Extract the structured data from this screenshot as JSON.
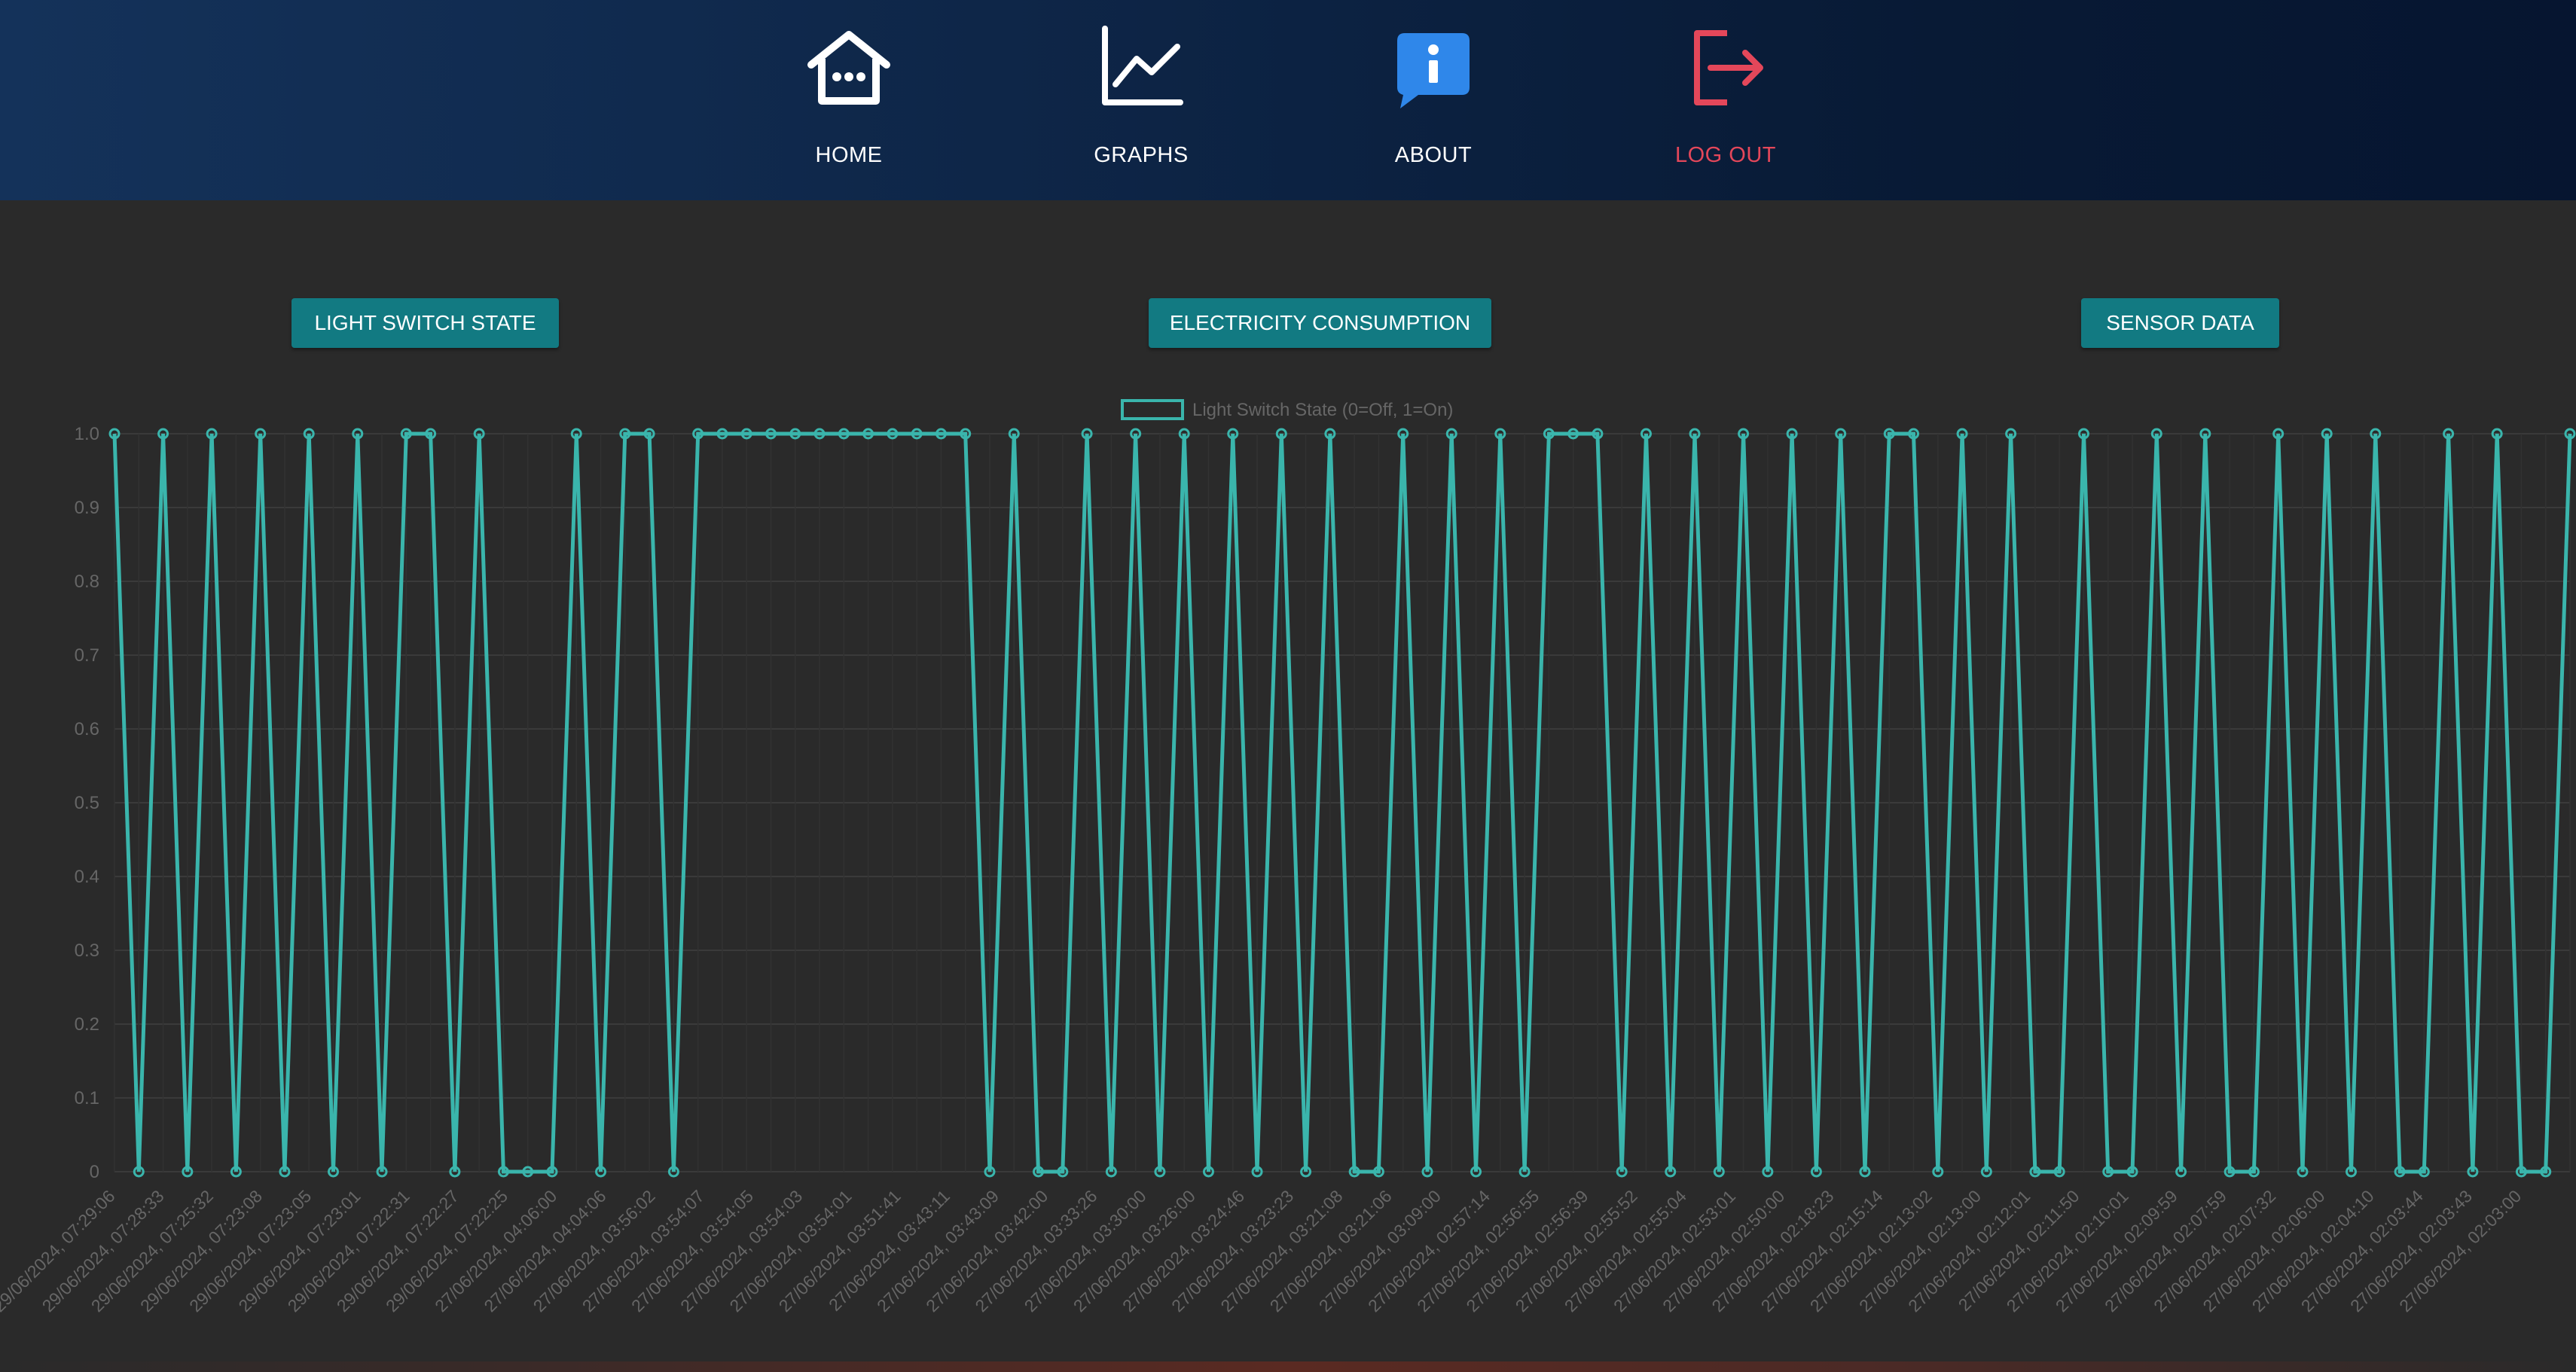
{
  "nav": {
    "items": [
      {
        "label": "HOME",
        "icon": "house-icon"
      },
      {
        "label": "GRAPHS",
        "icon": "line-chart-icon"
      },
      {
        "label": "ABOUT",
        "icon": "info-bubble-icon"
      },
      {
        "label": "LOG OUT",
        "icon": "logout-icon"
      }
    ]
  },
  "tabs": [
    {
      "label": "LIGHT SWITCH STATE"
    },
    {
      "label": "ELECTRICITY CONSUMPTION"
    },
    {
      "label": "SENSOR DATA"
    }
  ],
  "colors": {
    "accent": "#127a82",
    "series": "#3ab5ac",
    "logout": "#e4475a",
    "about_icon": "#2f87ea"
  },
  "chart_data": {
    "type": "line",
    "title": "",
    "legend": {
      "label": "Light Switch State (0=Off, 1=On)",
      "position": "top-center"
    },
    "ylim": [
      0,
      1
    ],
    "yticks": [
      "1.0",
      "0.9",
      "0.8",
      "0.7",
      "0.6",
      "0.5",
      "0.4",
      "0.3",
      "0.2",
      "0.1",
      "0"
    ],
    "grid": true,
    "xtick_labels": [
      "29/06/2024, 07:29:06",
      "29/06/2024, 07:28:33",
      "29/06/2024, 07:25:32",
      "29/06/2024, 07:23:08",
      "29/06/2024, 07:23:05",
      "29/06/2024, 07:23:01",
      "29/06/2024, 07:22:31",
      "29/06/2024, 07:22:27",
      "29/06/2024, 07:22:25",
      "27/06/2024, 04:06:00",
      "27/06/2024, 04:04:06",
      "27/06/2024, 03:56:02",
      "27/06/2024, 03:54:07",
      "27/06/2024, 03:54:05",
      "27/06/2024, 03:54:03",
      "27/06/2024, 03:54:01",
      "27/06/2024, 03:51:41",
      "27/06/2024, 03:43:11",
      "27/06/2024, 03:43:09",
      "27/06/2024, 03:42:00",
      "27/06/2024, 03:33:26",
      "27/06/2024, 03:30:00",
      "27/06/2024, 03:26:00",
      "27/06/2024, 03:24:46",
      "27/06/2024, 03:23:23",
      "27/06/2024, 03:21:08",
      "27/06/2024, 03:21:06",
      "27/06/2024, 03:09:00",
      "27/06/2024, 02:57:14",
      "27/06/2024, 02:56:55",
      "27/06/2024, 02:56:39",
      "27/06/2024, 02:55:52",
      "27/06/2024, 02:55:04",
      "27/06/2024, 02:53:01",
      "27/06/2024, 02:50:00",
      "27/06/2024, 02:18:23",
      "27/06/2024, 02:15:14",
      "27/06/2024, 02:13:02",
      "27/06/2024, 02:13:00",
      "27/06/2024, 02:12:01",
      "27/06/2024, 02:11:50",
      "27/06/2024, 02:10:01",
      "27/06/2024, 02:09:59",
      "27/06/2024, 02:07:59",
      "27/06/2024, 02:07:32",
      "27/06/2024, 02:06:00",
      "27/06/2024, 02:04:10",
      "27/06/2024, 02:03:44",
      "27/06/2024, 02:03:43",
      "27/06/2024, 02:03:00"
    ],
    "series": [
      {
        "name": "Light Switch State (0=Off, 1=On)",
        "values": [
          1,
          0,
          1,
          0,
          1,
          0,
          1,
          0,
          1,
          0,
          1,
          0,
          1,
          1,
          0,
          1,
          0,
          0,
          0,
          1,
          0,
          1,
          1,
          0,
          1,
          1,
          1,
          1,
          1,
          1,
          1,
          1,
          1,
          1,
          1,
          1,
          0,
          1,
          0,
          0,
          1,
          0,
          1,
          0,
          1,
          0,
          1,
          0,
          1,
          0,
          1,
          0,
          0,
          1,
          0,
          1,
          0,
          1,
          0,
          1,
          1,
          1,
          0,
          1,
          0,
          1,
          0,
          1,
          0,
          1,
          0,
          1,
          0,
          1,
          1,
          0,
          1,
          0,
          1,
          0,
          0,
          1,
          0,
          0,
          1,
          0,
          1,
          0,
          0,
          1,
          0,
          1,
          0,
          1,
          0,
          0,
          1,
          0,
          1,
          0,
          0,
          1
        ]
      }
    ]
  }
}
